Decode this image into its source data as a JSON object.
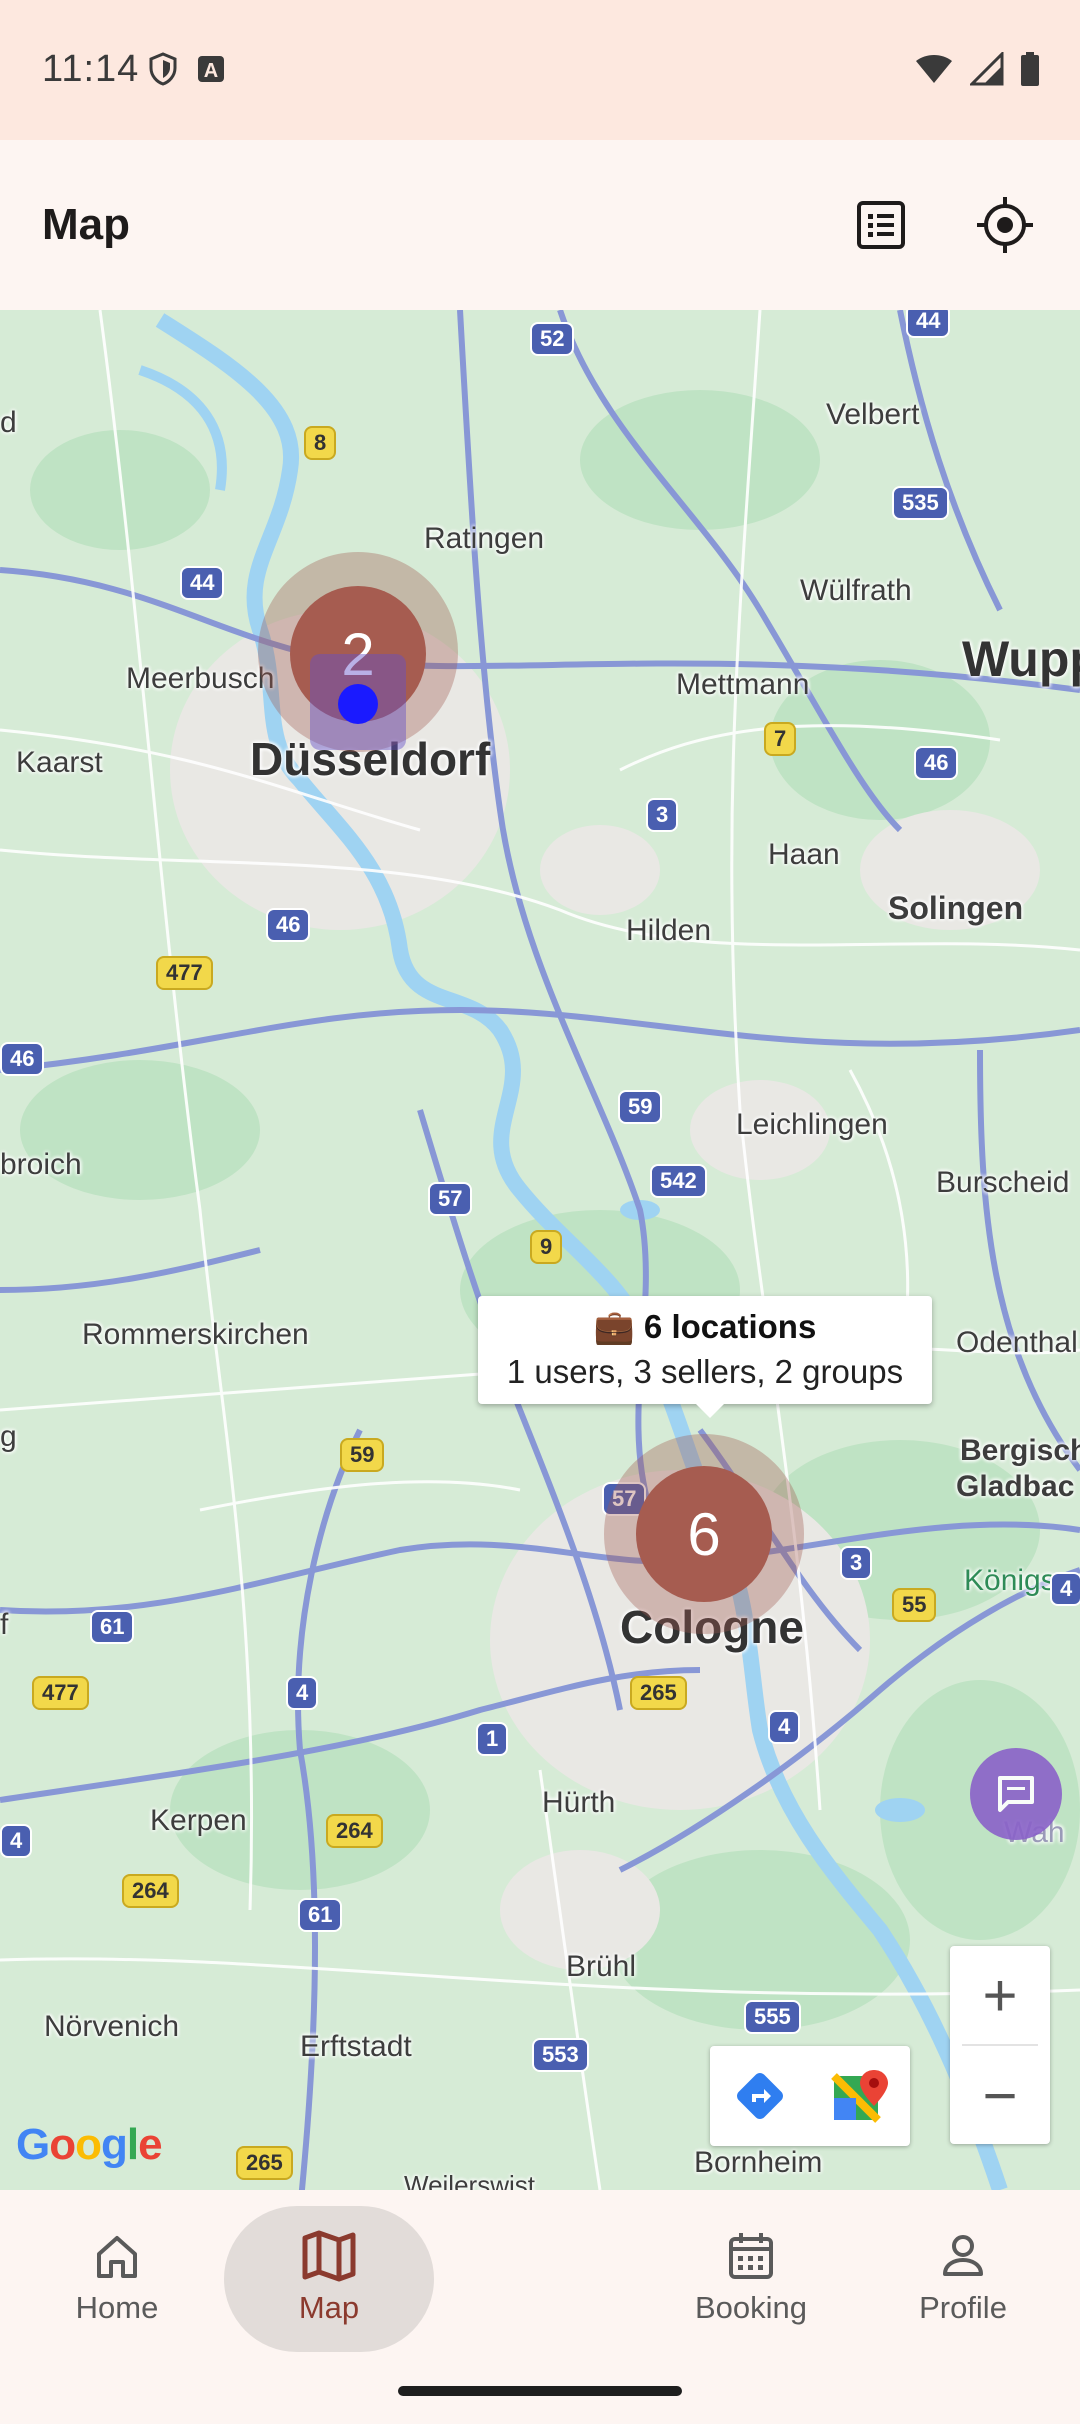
{
  "status_bar": {
    "time": "11:14"
  },
  "app_bar": {
    "title": "Map"
  },
  "map": {
    "places": {
      "dusseldorf": "Düsseldorf",
      "cologne": "Cologne",
      "ratingen": "Ratingen",
      "meerbusch": "Meerbusch",
      "kaarst": "Kaarst",
      "mettmann": "Mettmann",
      "wulfrath": "Wülfrath",
      "velbert": "Velbert",
      "wupp": "Wupp",
      "haan": "Haan",
      "solingen": "Solingen",
      "hilden": "Hilden",
      "leichlingen": "Leichlingen",
      "burscheid": "Burscheid",
      "broich": "broich",
      "rommerskirchen": "Rommerskirchen",
      "odenthal": "Odenthal",
      "bergisch1": "Bergisch",
      "bergisch2": "Gladbac",
      "konigs": "Königs",
      "kerpen": "Kerpen",
      "hurth": "Hürth",
      "bruhl": "Brühl",
      "norvenich": "Nörvenich",
      "erftstadt": "Erftstadt",
      "bornheim": "Bornheim",
      "weilerswist": "Weilerswist",
      "wah": "Wah",
      "d_left": "d",
      "g_left": "g",
      "f_left": "f"
    },
    "clusters": {
      "dusseldorf_count": "2",
      "cologne_count": "6"
    },
    "info_window": {
      "title": "💼 6 locations",
      "subtitle": "1 users, 3 sellers, 2 groups"
    },
    "zoom": {
      "in": "+",
      "out": "−"
    },
    "attribution": "Google"
  },
  "nav": {
    "items": [
      {
        "label": "Home"
      },
      {
        "label": "Map"
      },
      {
        "label": "Booking"
      },
      {
        "label": "Profile"
      }
    ]
  },
  "colors": {
    "accent": "#8b3a2e",
    "cluster": "#a65c50",
    "map_bg": "#d8ecd9"
  }
}
